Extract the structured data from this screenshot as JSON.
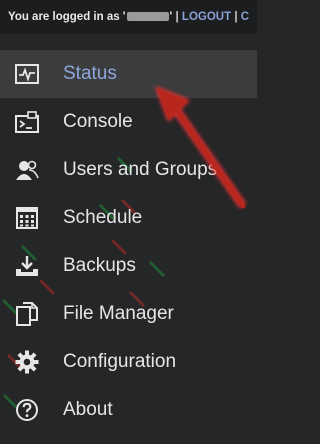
{
  "topbar": {
    "logged_in_prefix": "You are logged in as '",
    "logged_in_suffix": "'",
    "separator": "|",
    "logout_label": "LOGOUT",
    "truncated_link": "C"
  },
  "menu": {
    "items": [
      {
        "label": "Status",
        "icon": "status-monitor-icon"
      },
      {
        "label": "Console",
        "icon": "console-icon"
      },
      {
        "label": "Users and Groups",
        "icon": "users-icon"
      },
      {
        "label": "Schedule",
        "icon": "calendar-grid-icon"
      },
      {
        "label": "Backups",
        "icon": "download-tray-icon"
      },
      {
        "label": "File Manager",
        "icon": "files-icon"
      },
      {
        "label": "Configuration",
        "icon": "gear-icon"
      },
      {
        "label": "About",
        "icon": "question-circle-icon"
      }
    ],
    "active": "Status"
  },
  "colors": {
    "background": "#252627",
    "active_bg": "#3b3c3d",
    "active_text": "#8ea7dc",
    "link": "#8aa2d6",
    "annotation_arrow": "#c0281e"
  }
}
